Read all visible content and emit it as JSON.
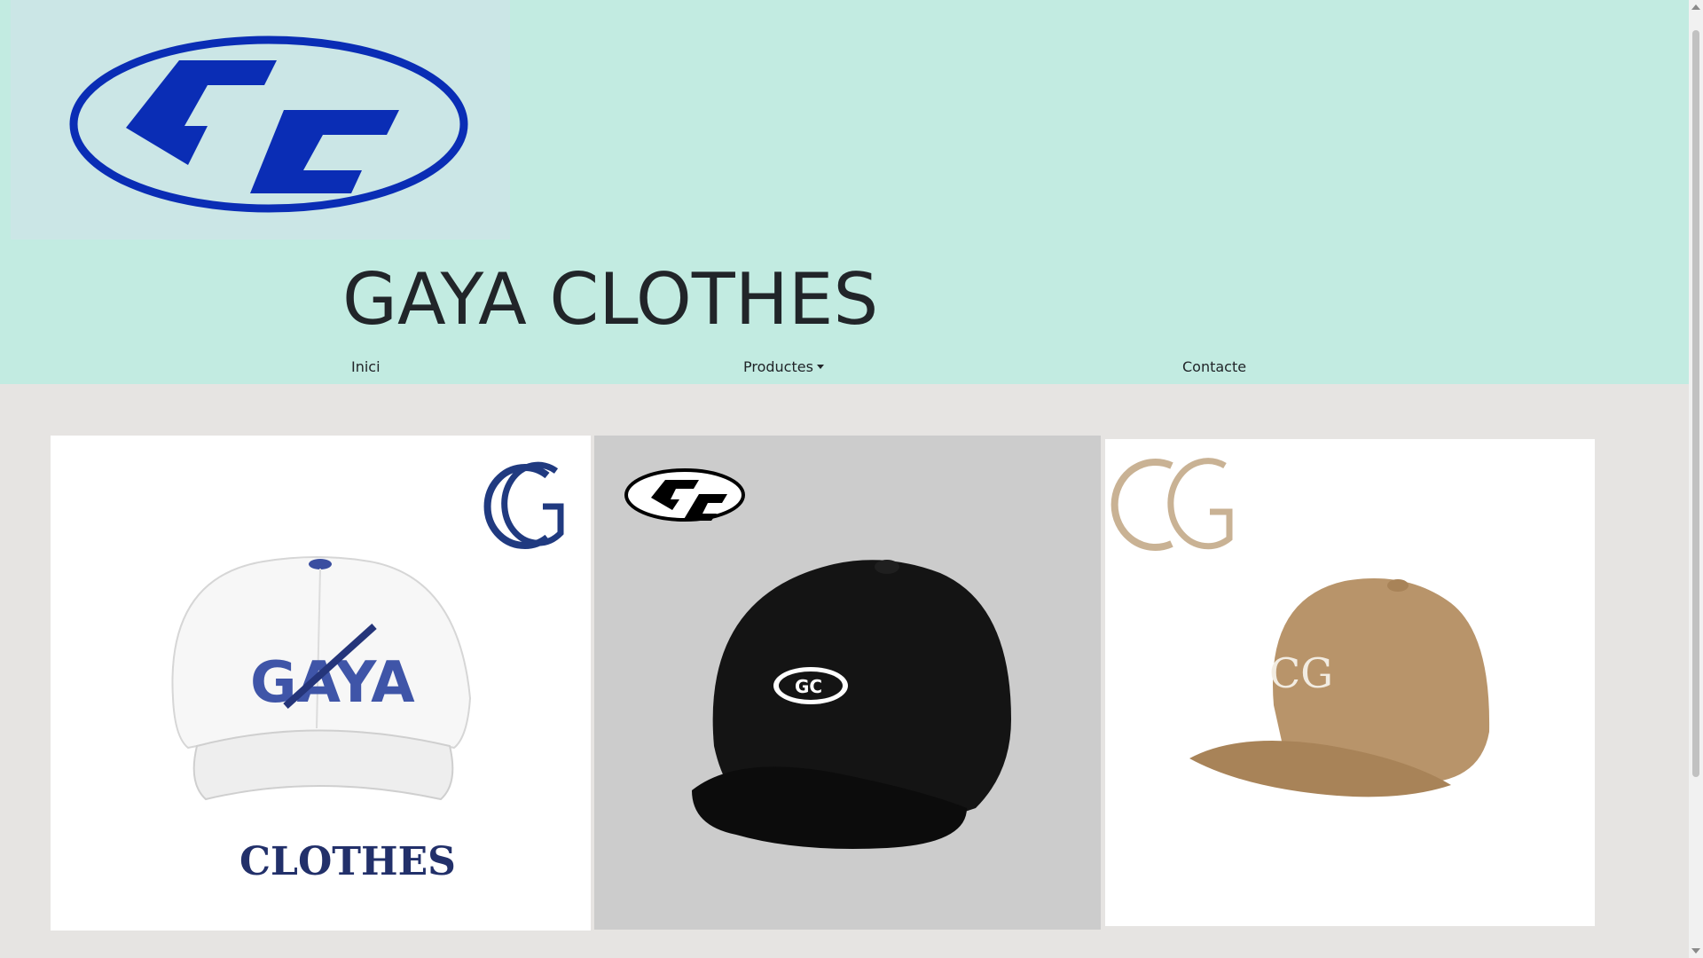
{
  "header": {
    "logo_text": "GC",
    "site_title": "GAYA CLOTHES"
  },
  "nav": {
    "home": "Inici",
    "products": "Productes",
    "contact": "Contacte"
  },
  "products": [
    {
      "name": "white-cap",
      "cap_color": "#f7f7f7",
      "logo_text": "GAYA",
      "brand_text": "CLOTHES",
      "monogram": "CG"
    },
    {
      "name": "black-cap",
      "cap_color": "#141414",
      "logo_text": "GC"
    },
    {
      "name": "tan-cap",
      "cap_color": "#b8946a",
      "monogram": "CG"
    }
  ],
  "colors": {
    "header_bg": "#c2ebe1",
    "logo_blue": "#0a2db5",
    "page_bg": "#e6e4e2"
  }
}
